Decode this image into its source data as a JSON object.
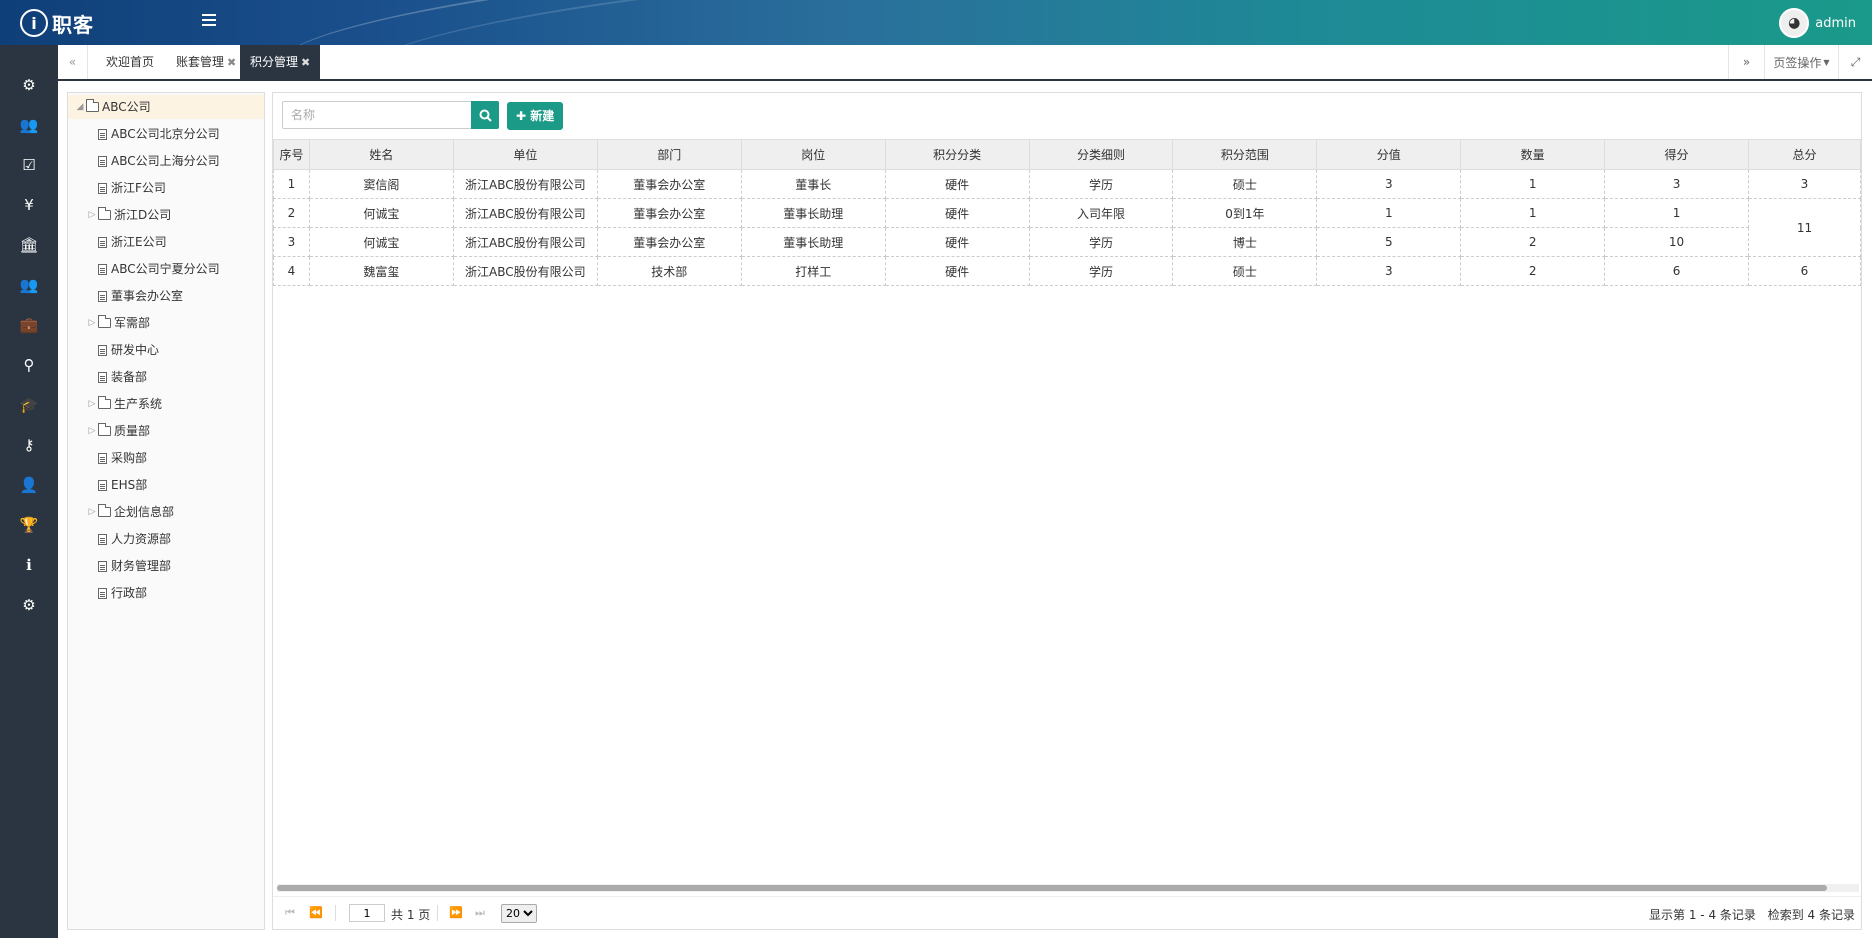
{
  "header": {
    "logo_mark": "i",
    "logo_text": "职客",
    "user_name": "admin"
  },
  "sidebar_icons": [
    "dashboard-icon",
    "users-icon",
    "check-square-icon",
    "yen-icon",
    "bank-icon",
    "group-icon",
    "briefcase-icon",
    "stamp-icon",
    "graduation-cap-icon",
    "tie-icon",
    "user-icon",
    "trophy-icon",
    "info-icon",
    "cogs-icon"
  ],
  "tabs": [
    {
      "label": "欢迎首页",
      "closable": false,
      "active": false
    },
    {
      "label": "账套管理",
      "closable": true,
      "active": false
    },
    {
      "label": "积分管理",
      "closable": true,
      "active": true
    }
  ],
  "tab_actions": {
    "page_ops": "页签操作"
  },
  "tree": [
    {
      "label": "ABC公司",
      "type": "folder-open",
      "level": 0
    },
    {
      "label": "ABC公司北京分公司",
      "type": "file",
      "level": 1
    },
    {
      "label": "ABC公司上海分公司",
      "type": "file",
      "level": 1
    },
    {
      "label": "浙江F公司",
      "type": "file",
      "level": 1
    },
    {
      "label": "浙江D公司",
      "type": "folder",
      "level": 1
    },
    {
      "label": "浙江E公司",
      "type": "file",
      "level": 1
    },
    {
      "label": "ABC公司宁夏分公司",
      "type": "file",
      "level": 1
    },
    {
      "label": "董事会办公室",
      "type": "file",
      "level": 1
    },
    {
      "label": "军需部",
      "type": "folder",
      "level": 1
    },
    {
      "label": "研发中心",
      "type": "file",
      "level": 1
    },
    {
      "label": "装备部",
      "type": "file",
      "level": 1
    },
    {
      "label": "生产系统",
      "type": "folder",
      "level": 1
    },
    {
      "label": "质量部",
      "type": "folder",
      "level": 1
    },
    {
      "label": "采购部",
      "type": "file",
      "level": 1
    },
    {
      "label": "EHS部",
      "type": "file",
      "level": 1
    },
    {
      "label": "企划信息部",
      "type": "folder",
      "level": 1
    },
    {
      "label": "人力资源部",
      "type": "file",
      "level": 1
    },
    {
      "label": "财务管理部",
      "type": "file",
      "level": 1
    },
    {
      "label": "行政部",
      "type": "file",
      "level": 1
    }
  ],
  "toolbar": {
    "search_placeholder": "名称",
    "new_label": "新建"
  },
  "table": {
    "columns": [
      "序号",
      "姓名",
      "单位",
      "部门",
      "岗位",
      "积分分类",
      "分类细则",
      "积分范围",
      "分值",
      "数量",
      "得分",
      "总分"
    ],
    "rows": [
      [
        "1",
        "窦信阁",
        "浙江ABC股份有限公司",
        "董事会办公室",
        "董事长",
        "硬件",
        "学历",
        "硕士",
        "3",
        "1",
        "3"
      ],
      [
        "2",
        "何诚宝",
        "浙江ABC股份有限公司",
        "董事会办公室",
        "董事长助理",
        "硬件",
        "入司年限",
        "0到1年",
        "1",
        "1",
        "1"
      ],
      [
        "3",
        "何诚宝",
        "浙江ABC股份有限公司",
        "董事会办公室",
        "董事长助理",
        "硬件",
        "学历",
        "博士",
        "5",
        "2",
        "10"
      ],
      [
        "4",
        "魏富玺",
        "浙江ABC股份有限公司",
        "技术部",
        "打样工",
        "硬件",
        "学历",
        "硕士",
        "3",
        "2",
        "6"
      ]
    ],
    "totals": [
      "3",
      "11",
      "6"
    ]
  },
  "pager": {
    "current_page": "1",
    "total_pages": "共 1 页",
    "page_size": "20",
    "range_info": "显示第 1 - 4 条记录",
    "found_info": "检索到 4 条记录"
  }
}
